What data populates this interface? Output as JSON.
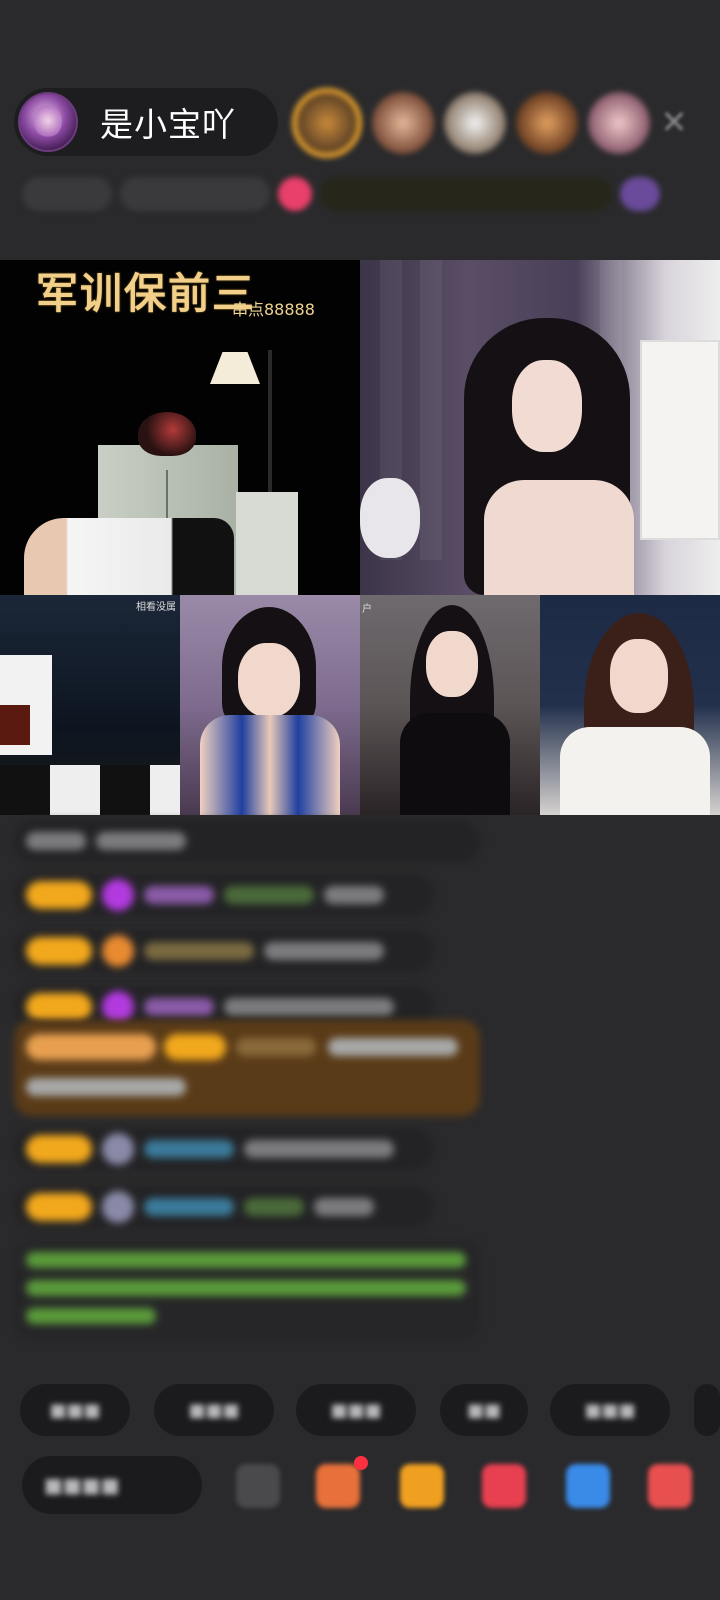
{
  "header": {
    "host_name": "是小宝吖"
  },
  "stream": {
    "banner_title": "军训保前三",
    "banner_subtitle": "串点88888",
    "tile_labels": [
      "相看没属",
      "户"
    ]
  },
  "colors": {
    "background": "#2a2a2c",
    "badge": "#f2a81c",
    "banner_text": "#f3d08a",
    "host_pill": "#1d1d1f"
  },
  "icons": {
    "close": "close-icon",
    "more": "more-icon",
    "gift": "gift-icon",
    "game": "game-icon",
    "share": "share-icon"
  }
}
